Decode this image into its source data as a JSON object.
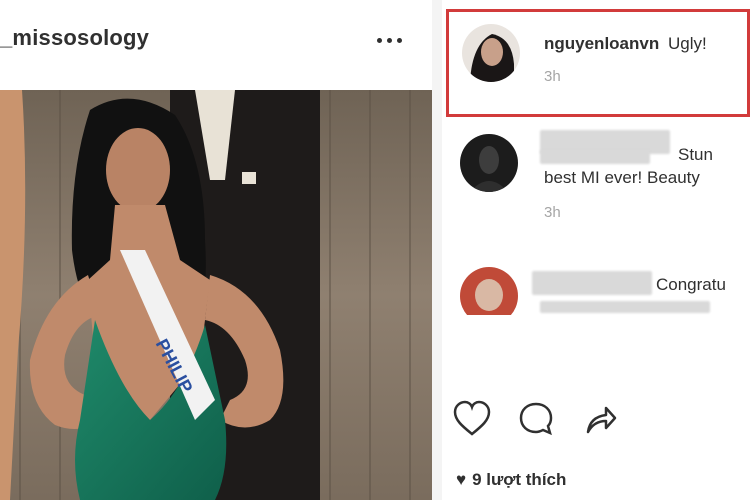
{
  "post": {
    "username": "_missosology",
    "sash_text": "PHILIP"
  },
  "comments": [
    {
      "author": "nguyenloanvn",
      "text": "Ugly!",
      "time": "3h",
      "highlighted": true
    },
    {
      "author": "",
      "text": "Stun",
      "text2": "best MI ever! Beauty",
      "time": "3h"
    },
    {
      "author": "",
      "text": "Congratu"
    }
  ],
  "actions": {
    "like_icon": "heart-outline-icon",
    "comment_icon": "speech-bubble-icon",
    "share_icon": "share-arrow-icon"
  },
  "likes": {
    "heart_glyph": "♥",
    "label": "9 lượt thích"
  },
  "colors": {
    "highlight": "#d23b3b",
    "text": "#303030",
    "muted": "#a5a5a5"
  }
}
